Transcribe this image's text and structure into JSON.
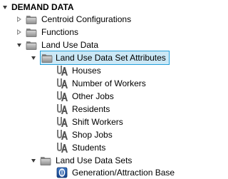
{
  "tree": {
    "root": {
      "label": "DEMAND DATA",
      "icon": "collapse-arrow-icon"
    },
    "items": [
      {
        "label": "Centroid Configurations",
        "icon": "folder-icon",
        "state": "collapsed"
      },
      {
        "label": "Functions",
        "icon": "folder-icon",
        "state": "collapsed"
      },
      {
        "label": "Land Use Data",
        "icon": "folder-icon",
        "state": "expanded"
      },
      {
        "label": "Land Use Data Set Attributes",
        "icon": "folder-icon",
        "state": "expanded",
        "selected": true
      },
      {
        "label": "Houses",
        "icon": "land-use-attribute-icon"
      },
      {
        "label": "Number of Workers",
        "icon": "land-use-attribute-icon"
      },
      {
        "label": "Other Jobs",
        "icon": "land-use-attribute-icon"
      },
      {
        "label": "Residents",
        "icon": "land-use-attribute-icon"
      },
      {
        "label": "Shift Workers",
        "icon": "land-use-attribute-icon"
      },
      {
        "label": "Shop Jobs",
        "icon": "land-use-attribute-icon"
      },
      {
        "label": "Students",
        "icon": "land-use-attribute-icon"
      },
      {
        "label": "Land Use Data Sets",
        "icon": "folder-icon",
        "state": "expanded"
      },
      {
        "label": "Generation/Attraction Base",
        "icon": "generation-attraction-icon"
      }
    ]
  },
  "colors": {
    "selection_bg": "#cbe8f6",
    "selection_border": "#26a0da",
    "folder_dark": "#6e6e6e",
    "folder_light": "#bdbdbd"
  }
}
